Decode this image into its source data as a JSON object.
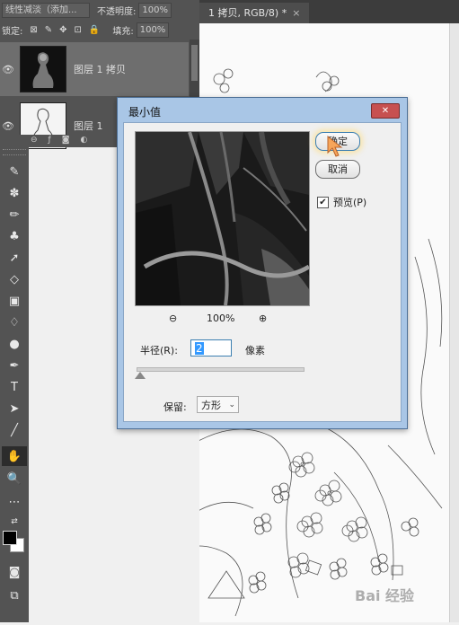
{
  "layers_panel": {
    "blend_mode": "线性减淡（添加...",
    "opacity_label": "不透明度:",
    "opacity_value": "100%",
    "lock_label": "锁定:",
    "fill_label": "填充:",
    "fill_value": "100%",
    "layers": [
      {
        "name": "图层 1 拷贝",
        "visible": true,
        "selected": true
      },
      {
        "name": "图层 1",
        "visible": true,
        "selected": false
      }
    ]
  },
  "document": {
    "tab_title": "1 拷贝, RGB/8) *"
  },
  "dialog": {
    "title": "最小值",
    "close_icon": "close-icon",
    "ok_label": "确定",
    "cancel_label": "取消",
    "preview_label": "预览(P)",
    "preview_checked": true,
    "zoom_level": "100%",
    "radius_label": "半径(R):",
    "radius_value": "2",
    "radius_unit": "像素",
    "keep_label": "保留:",
    "keep_value": "方形",
    "slider_position": 0.0
  },
  "colors": {
    "dialog_frame": "#a9c6e6",
    "close_button": "#c75050",
    "panel_dark": "#535353"
  }
}
